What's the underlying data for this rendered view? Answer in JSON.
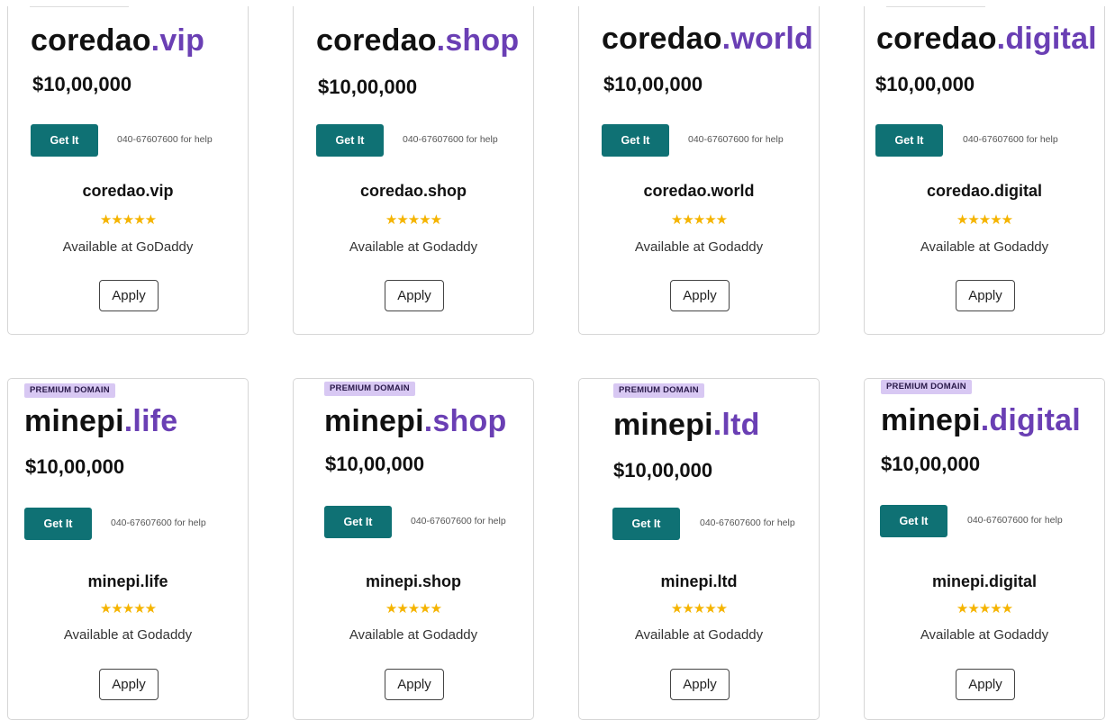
{
  "help_text": "040-67607600 for help",
  "get_it_label": "Get It",
  "apply_label": "Apply",
  "badge_label": "PREMIUM DOMAIN",
  "star_glyphs": "★★★★★",
  "rating_stars": 5,
  "accent_color": "#6a3fb4",
  "button_color": "#0f7174",
  "star_color": "#f5b400",
  "row1": [
    {
      "sld": "coredao",
      "tld": ".vip",
      "price": "$10,00,000",
      "name": "coredao.vip",
      "availability": "Available at GoDaddy"
    },
    {
      "sld": "coredao",
      "tld": ".shop",
      "price": "$10,00,000",
      "name": "coredao.shop",
      "availability": "Available at Godaddy"
    },
    {
      "sld": "coredao",
      "tld": ".world",
      "price": "$10,00,000",
      "name": "coredao.world",
      "availability": "Available at Godaddy"
    },
    {
      "sld": "coredao",
      "tld": ".digital",
      "price": "$10,00,000",
      "name": "coredao.digital",
      "availability": "Available at Godaddy"
    }
  ],
  "row2": [
    {
      "sld": "minepi",
      "tld": ".life",
      "price": "$10,00,000",
      "name": "minepi.life",
      "availability": "Available at Godaddy"
    },
    {
      "sld": "minepi",
      "tld": ".shop",
      "price": "$10,00,000",
      "name": "minepi.shop",
      "availability": "Available at Godaddy"
    },
    {
      "sld": "minepi",
      "tld": ".ltd",
      "price": "$10,00,000",
      "name": "minepi.ltd",
      "availability": "Available at Godaddy"
    },
    {
      "sld": "minepi",
      "tld": ".digital",
      "price": "$10,00,000",
      "name": "minepi.digital",
      "availability": "Available at Godaddy"
    }
  ]
}
